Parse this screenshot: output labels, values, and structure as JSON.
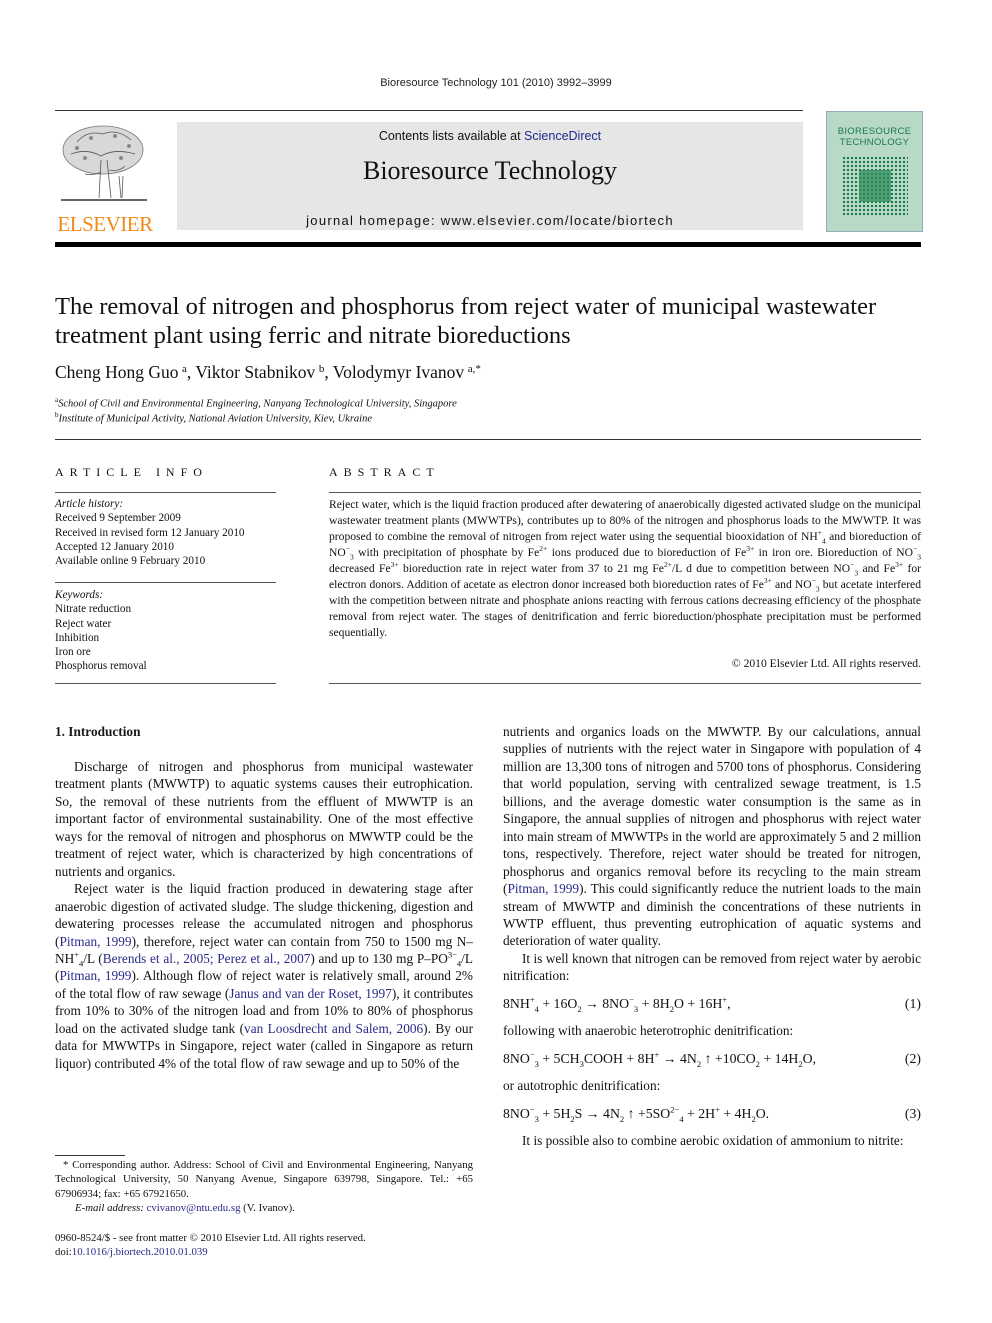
{
  "running_head": "Bioresource Technology 101 (2010) 3992–3999",
  "masthead": {
    "publisher_wordmark": "ELSEVIER",
    "contents_prefix": "Contents lists available at ",
    "contents_link": "ScienceDirect",
    "journal_title": "Bioresource Technology",
    "homepage": "journal homepage: www.elsevier.com/locate/biortech",
    "cover_title_line1": "BIORESOURCE",
    "cover_title_line2": "TECHNOLOGY",
    "colors": {
      "elsevier_orange": "#f28a1b",
      "link_blue": "#1e2a8c",
      "banner_gray": "#e6e6e6",
      "cover_green": "#b8d9c6"
    }
  },
  "article": {
    "title": "The removal of nitrogen and phosphorus from reject water of municipal wastewater treatment plant using ferric and nitrate bioreductions",
    "authors": [
      {
        "name": "Cheng Hong Guo",
        "marks": "a",
        "sep": ", "
      },
      {
        "name": "Viktor Stabnikov",
        "marks": "b",
        "sep": ", "
      },
      {
        "name": "Volodymyr Ivanov",
        "marks": "a,*",
        "sep": ""
      }
    ],
    "affiliations": [
      {
        "mark": "a",
        "text": "School of Civil and Environmental Engineering, Nanyang Technological University, Singapore"
      },
      {
        "mark": "b",
        "text": "Institute of Municipal Activity, National Aviation University, Kiev, Ukraine"
      }
    ]
  },
  "article_info": {
    "heading": "ARTICLE INFO",
    "history_label": "Article history:",
    "history": [
      "Received 9 September 2009",
      "Received in revised form 12 January 2010",
      "Accepted 12 January 2010",
      "Available online 9 February 2010"
    ],
    "keywords_label": "Keywords:",
    "keywords": [
      "Nitrate reduction",
      "Reject water",
      "Inhibition",
      "Iron ore",
      "Phosphorus removal"
    ]
  },
  "abstract": {
    "heading": "ABSTRACT",
    "segments": [
      "Reject water, which is the liquid fraction produced after dewatering of anaerobically digested activated sludge on the municipal wastewater treatment plants (MWWTPs), contributes up to 80% of the nitrogen and phosphorus loads to the MWWTP. It was proposed to combine the removal of nitrogen from reject water using the sequential biooxidation of NH",
      "and bioreduction of NO",
      "with precipitation of phosphate by Fe",
      "ions produced due to bioreduction of Fe",
      "in iron ore. Bioreduction of NO",
      "decreased Fe",
      "bioreduction rate in reject water from 37 to 21 mg Fe",
      "/L d due to competition between NO",
      "and Fe",
      "for electron donors. Addition of acetate as electron donor increased both bioreduction rates of Fe",
      "and NO",
      "but acetate interfered with the competition between nitrate and phosphate anions reacting with ferrous cations decreasing efficiency of the phosphate removal from reject water. The stages of denitrification and ferric bioreduction/phosphate precipitation must be performed sequentially."
    ],
    "copyright": "© 2010 Elsevier Ltd. All rights reserved."
  },
  "introduction": {
    "heading": "1. Introduction",
    "p1": "Discharge of nitrogen and phosphorus from municipal wastewater treatment plants (MWWTP) to aquatic systems causes their eutrophication. So, the removal of these nutrients from the effluent of MWWTP is an important factor of environmental sustainability. One of the most effective ways for the removal of nitrogen and phosphorus on MWWTP could be the treatment of reject water, which is characterized by high concentrations of nutrients and organics.",
    "p2": {
      "t1": "Reject water is the liquid fraction produced in dewatering stage after anaerobic digestion of activated sludge. The sludge thickening, digestion and dewatering processes release the accumulated nitrogen and phosphorus (",
      "c1": "Pitman, 1999",
      "t2": "), therefore, reject water can contain from 750 to 1500 mg N–NH",
      "t3": "/L (",
      "c2": "Berends et al., 2005; Perez et al., 2007",
      "t4": ") and up to 130 mg P–PO",
      "t5": "/L (",
      "c3": "Pitman, 1999",
      "t6": "). Although flow of reject water is relatively small, around 2% of the total flow of raw sewage (",
      "c4": "Janus and van der Roset, 1997",
      "t7": "), it contributes from 10% to 30% of the nitrogen load and from 10% to 80% of phosphorus load on the activated sludge tank (",
      "c5": "van Loosdrecht and Salem, 2006",
      "t8": "). By our data for MWWTPs in Singapore, reject water (called in Singapore as return liquor) contributed 4% of the total flow of raw sewage and up to 50% of the"
    },
    "p3": {
      "t1": "nutrients and organics loads on the MWWTP. By our calculations, annual supplies of nutrients with the reject water in Singapore with population of 4 million are 13,300 tons of nitrogen and 5700 tons of phosphorus. Considering that world population, serving with centralized sewage treatment, is 1.5 billions, and the average domestic water consumption is the same as in Singapore, the annual supplies of nitrogen and phosphorus with reject water into main stream of MWWTPs in the world are approximately 5 and 2 million tons, respectively. Therefore, reject water should be treated for nitrogen, phosphorus and organics removal before its recycling to the main stream (",
      "c1": "Pitman, 1999",
      "t2": "). This could significantly reduce the nutrient loads to the main stream of MWWTP and diminish the concentrations of these nutrients in WWTP effluent, thus preventing eutrophication of aquatic systems and deterioration of water quality."
    },
    "p4": "It is well known that nitrogen can be removed from reject water by aerobic nitrification:",
    "eq1_num": "(1)",
    "between_1_2": "following with anaerobic heterotrophic denitrification:",
    "eq2_num": "(2)",
    "between_2_3": "or autotrophic denitrification:",
    "eq3_num": "(3)",
    "p5": "It is possible also to combine aerobic oxidation of ammonium to nitrite:"
  },
  "footnote": {
    "corresponding": "* Corresponding author. Address: School of Civil and Environmental Engineering, Nanyang Technological University, 50 Nanyang Avenue, Singapore 639798, Singapore. Tel.: +65 67906934; fax: +65 67921650.",
    "email_label": "E-mail address: ",
    "email": "cvivanov@ntu.edu.sg",
    "email_suffix": " (V. Ivanov).",
    "front_matter": "0960-8524/$ - see front matter © 2010 Elsevier Ltd. All rights reserved.",
    "doi_label": "doi:",
    "doi": "10.1016/j.biortech.2010.01.039"
  }
}
